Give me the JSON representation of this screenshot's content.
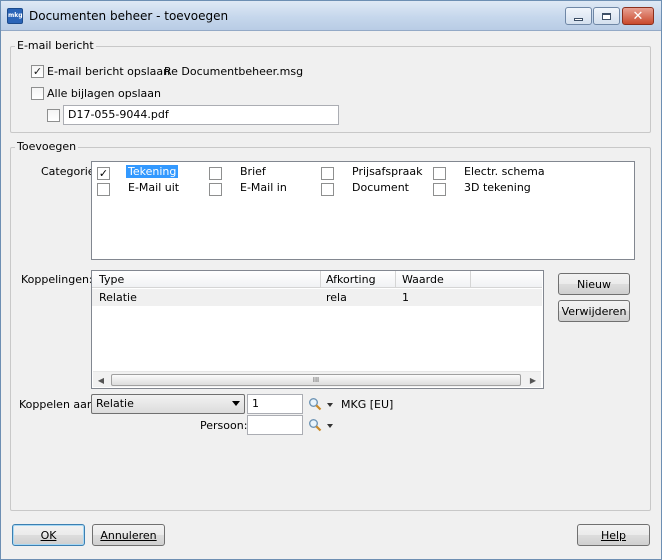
{
  "window": {
    "title": "Documenten beheer - toevoegen",
    "app_icon_text": "mkg"
  },
  "email": {
    "legend": "E-mail bericht",
    "save_message_label": "E-mail bericht opslaan",
    "save_message_checked": true,
    "message_file": "Re Documentbeheer.msg",
    "save_attachments_label": "Alle bijlagen opslaan",
    "save_attachments_checked": false,
    "attachment_file": "D17-055-9044.pdf",
    "attachment_checked": false
  },
  "add": {
    "legend": "Toevoegen",
    "category_label": "Categorie:",
    "categories": [
      {
        "label": "Tekening",
        "checked": true,
        "selected": true
      },
      {
        "label": "Brief",
        "checked": false
      },
      {
        "label": "Prijsafspraak",
        "checked": false
      },
      {
        "label": "Electr. schema",
        "checked": false
      },
      {
        "label": "E-Mail uit",
        "checked": false
      },
      {
        "label": "E-Mail in",
        "checked": false
      },
      {
        "label": "Document",
        "checked": false
      },
      {
        "label": "3D tekening",
        "checked": false
      }
    ],
    "links_label": "Koppelingen:",
    "links_columns": [
      "Type",
      "Afkorting",
      "Waarde"
    ],
    "links_rows": [
      {
        "type": "Relatie",
        "abbr": "rela",
        "value": "1"
      }
    ],
    "scroll_thumb_glyph": "III",
    "new_button": "Nieuw",
    "remove_button": "Verwijderen",
    "link_to_label": "Koppelen aan:",
    "link_to_value": "Relatie",
    "link_number": "1",
    "link_company": "MKG [EU]",
    "person_label": "Persoon:",
    "person_value": ""
  },
  "footer": {
    "ok": "OK",
    "cancel": "Annuleren",
    "help": "Help"
  }
}
